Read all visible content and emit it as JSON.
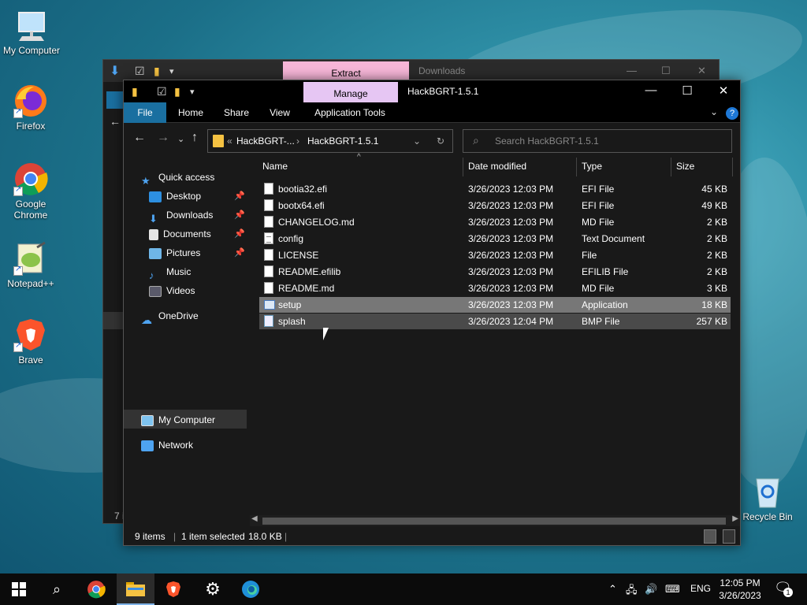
{
  "desktop": {
    "icons": [
      {
        "label": "My Computer"
      },
      {
        "label": "Firefox"
      },
      {
        "label": "Google Chrome"
      },
      {
        "label": "Notepad++"
      },
      {
        "label": "Brave"
      },
      {
        "label": "Recycle Bin"
      }
    ]
  },
  "back_window": {
    "title": "Downloads",
    "context_tab": "Extract",
    "status": "7 i"
  },
  "window": {
    "title": "HackBGRT-1.5.1",
    "context_tab": "Manage",
    "ribbon_tabs": [
      "File",
      "Home",
      "Share",
      "View",
      "Application Tools"
    ],
    "breadcrumb_prefix": "«",
    "breadcrumb": [
      "HackBGRT-...",
      "HackBGRT-1.5.1"
    ],
    "search_placeholder": "Search HackBGRT-1.5.1",
    "nav": {
      "quick_access": "Quick access",
      "items": [
        "Desktop",
        "Downloads",
        "Documents",
        "Pictures",
        "Music",
        "Videos"
      ],
      "onedrive": "OneDrive",
      "my_computer": "My Computer",
      "network": "Network"
    },
    "columns": [
      "Name",
      "Date modified",
      "Type",
      "Size"
    ],
    "files": [
      {
        "name": "bootia32.efi",
        "date": "3/26/2023 12:03 PM",
        "type": "EFI File",
        "size": "45 KB"
      },
      {
        "name": "bootx64.efi",
        "date": "3/26/2023 12:03 PM",
        "type": "EFI File",
        "size": "49 KB"
      },
      {
        "name": "CHANGELOG.md",
        "date": "3/26/2023 12:03 PM",
        "type": "MD File",
        "size": "2 KB"
      },
      {
        "name": "config",
        "date": "3/26/2023 12:03 PM",
        "type": "Text Document",
        "size": "2 KB"
      },
      {
        "name": "LICENSE",
        "date": "3/26/2023 12:03 PM",
        "type": "File",
        "size": "2 KB"
      },
      {
        "name": "README.efilib",
        "date": "3/26/2023 12:03 PM",
        "type": "EFILIB File",
        "size": "2 KB"
      },
      {
        "name": "README.md",
        "date": "3/26/2023 12:03 PM",
        "type": "MD File",
        "size": "3 KB"
      },
      {
        "name": "setup",
        "date": "3/26/2023 12:03 PM",
        "type": "Application",
        "size": "18 KB"
      },
      {
        "name": "splash",
        "date": "3/26/2023 12:04 PM",
        "type": "BMP File",
        "size": "257 KB"
      }
    ],
    "status": {
      "items": "9 items",
      "selected": "1 item selected",
      "size": "18.0 KB"
    }
  },
  "taskbar": {
    "language": "ENG",
    "time": "12:05 PM",
    "date": "3/26/2023",
    "notifications": "1"
  },
  "colors": {
    "accent_file_tab": "#1a6fa0",
    "manage_tab": "#e6c6f3",
    "extract_tab": "#f7b6d8",
    "selected_row": "#777777"
  }
}
